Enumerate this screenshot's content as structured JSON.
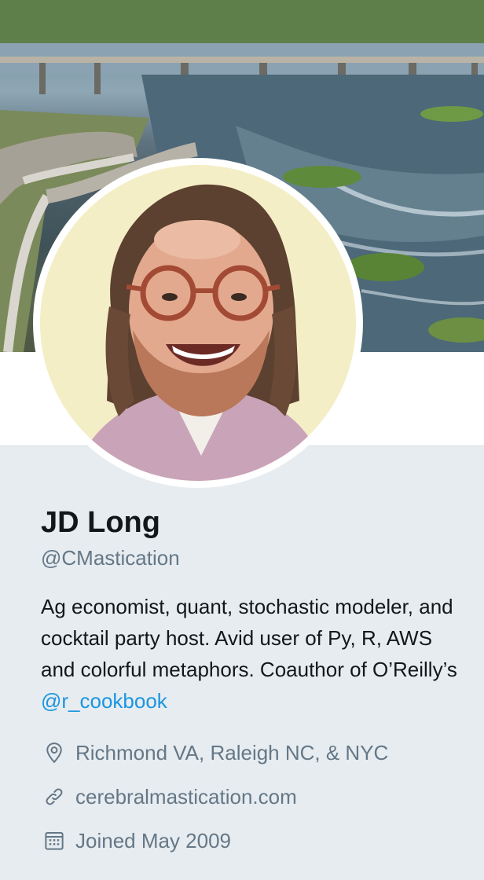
{
  "profile": {
    "name": "JD Long",
    "handle": "@CMastication",
    "bio_text": "Ag economist, quant, stochastic modeler, and cocktail party host. Avid user of Py, R, AWS and colorful metaphors. Coauthor of O’Reilly’s ",
    "bio_link": "@r_cookbook",
    "location": "Richmond VA, Raleigh NC, & NYC",
    "website": "cerebralmastication.com",
    "joined": "Joined May 2009"
  },
  "icons": {
    "location": "location-pin-icon",
    "website": "link-icon",
    "joined": "calendar-icon"
  },
  "colors": {
    "accent": "#1b95e0",
    "text": "#14171a",
    "secondary": "#657786",
    "background": "#e6ecf0"
  }
}
